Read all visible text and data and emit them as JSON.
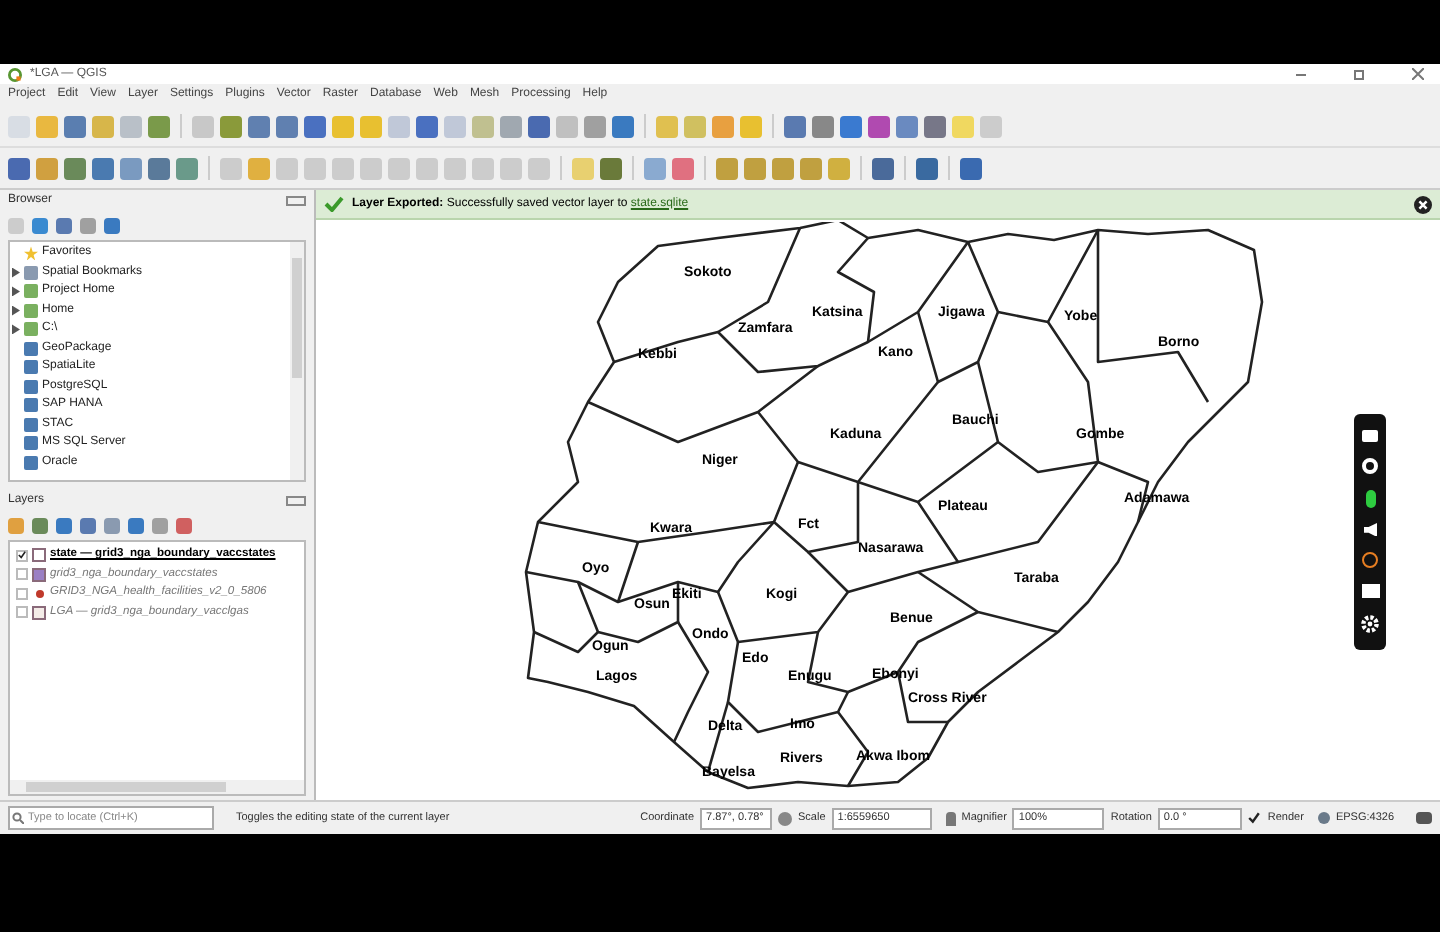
{
  "window": {
    "title": "*LGA — QGIS"
  },
  "menu": [
    "Project",
    "Edit",
    "View",
    "Layer",
    "Settings",
    "Plugins",
    "Vector",
    "Raster",
    "Database",
    "Web",
    "Mesh",
    "Processing",
    "Help"
  ],
  "browser": {
    "title": "Browser",
    "items": [
      {
        "label": "Favorites",
        "expandable": false
      },
      {
        "label": "Spatial Bookmarks",
        "expandable": true
      },
      {
        "label": "Project Home",
        "expandable": true
      },
      {
        "label": "Home",
        "expandable": true
      },
      {
        "label": "C:\\",
        "expandable": true
      },
      {
        "label": "GeoPackage",
        "expandable": false
      },
      {
        "label": "SpatiaLite",
        "expandable": false
      },
      {
        "label": "PostgreSQL",
        "expandable": false
      },
      {
        "label": "SAP HANA",
        "expandable": false
      },
      {
        "label": "STAC",
        "expandable": false
      },
      {
        "label": "MS SQL Server",
        "expandable": false
      },
      {
        "label": "Oracle",
        "expandable": false
      }
    ]
  },
  "layers": {
    "title": "Layers",
    "items": [
      {
        "label": "state — grid3_nga_boundary_vaccstates",
        "checked": true,
        "selected": true,
        "dimmed": false,
        "kind": "polygon",
        "color": "#ffffff"
      },
      {
        "label": "grid3_nga_boundary_vaccstates",
        "checked": false,
        "selected": false,
        "dimmed": true,
        "kind": "polygon",
        "color": "#9b7fc4"
      },
      {
        "label": "GRID3_NGA_health_facilities_v2_0_5806",
        "checked": false,
        "selected": false,
        "dimmed": true,
        "kind": "point",
        "color": "#c0392b"
      },
      {
        "label": "LGA — grid3_nga_boundary_vacclgas",
        "checked": false,
        "selected": false,
        "dimmed": true,
        "kind": "polygon",
        "color": "#f4ece8"
      }
    ]
  },
  "message": {
    "title": "Layer Exported:",
    "text": "Successfully saved vector layer to",
    "link": "state.sqlite"
  },
  "map": {
    "states": [
      "Sokoto",
      "Katsina",
      "Jigawa",
      "Yobe",
      "Zamfara",
      "Kebbi",
      "Kano",
      "Borno",
      "Kaduna",
      "Bauchi",
      "Gombe",
      "Niger",
      "Adamawa",
      "Plateau",
      "Fct",
      "Kwara",
      "Nasarawa",
      "Oyo",
      "Taraba",
      "Ekiti",
      "Kogi",
      "Osun",
      "Benue",
      "Ondo",
      "Ogun",
      "Edo",
      "Lagos",
      "Enugu",
      "Ebonyi",
      "Cross River",
      "Delta",
      "Imo",
      "Rivers",
      "Akwa Ibom",
      "Bayelsa"
    ]
  },
  "status_bar": {
    "locator_placeholder": "Type to locate (Ctrl+K)",
    "message": "Toggles the editing state of the current layer",
    "coordinate_label": "Coordinate",
    "coordinate": "7.87°, 0.78°",
    "scale_label": "Scale",
    "scale": "1:6559650",
    "magnifier_label": "Magnifier",
    "magnifier": "100%",
    "rotation_label": "Rotation",
    "rotation": "0.0 °",
    "render_label": "Render",
    "render": true,
    "crs": "EPSG:4326"
  }
}
